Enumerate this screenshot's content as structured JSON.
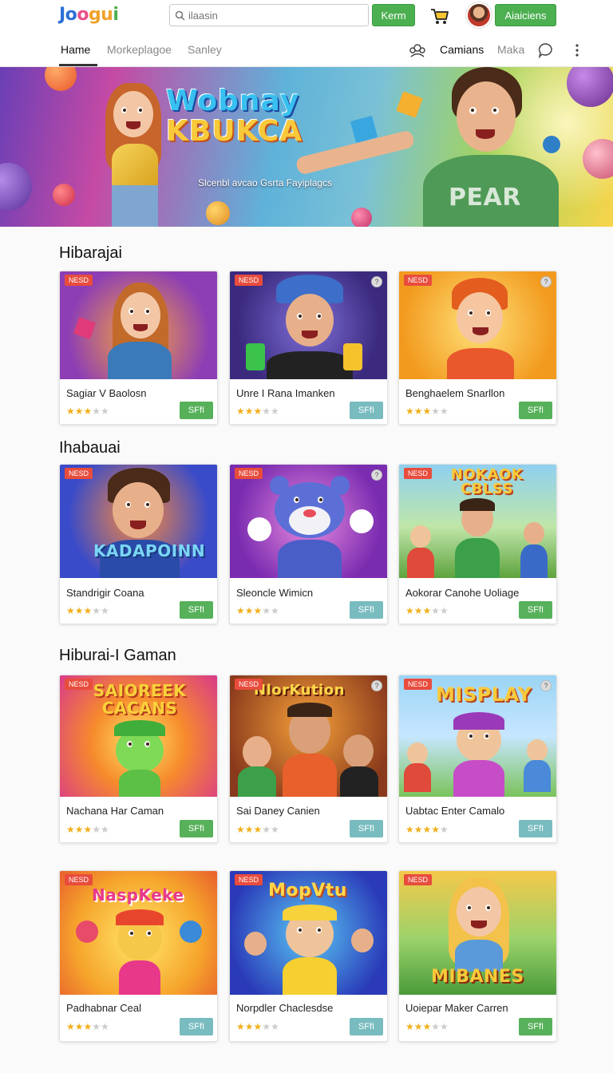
{
  "header": {
    "logo": [
      "Jo",
      "o",
      "gu",
      "i"
    ],
    "search_placeholder": "ilaasin",
    "search_button": "Kerm",
    "account_button": "Aiaiciens"
  },
  "nav": {
    "tabs": [
      {
        "label": "Hame",
        "active": true
      },
      {
        "label": "Morkeplagoe",
        "active": false
      },
      {
        "label": "Sanley",
        "active": false
      }
    ],
    "right_link_1": "Camians",
    "right_link_2": "Maka"
  },
  "banner": {
    "title_line1": "Wobnay",
    "title_line2": "KBUKCA",
    "subtitle": "Slcenbl avcao Gsrta Fayiplagcs",
    "shirt_text": "PEAR"
  },
  "sections": [
    {
      "title": "Hibarajai",
      "cards": [
        {
          "badge": "NESD",
          "title": "Sagiar V Baolosn",
          "rating": 3,
          "play": "SFfI",
          "play_style": "green",
          "art": ""
        },
        {
          "badge": "NESD",
          "title": "Unre I Rana Imanken",
          "rating": 3,
          "play": "SFfI",
          "play_style": "teal",
          "art": ""
        },
        {
          "badge": "NESD",
          "title": "Benghaelem Snarllon",
          "rating": 3,
          "play": "SFfI",
          "play_style": "green",
          "art": ""
        }
      ]
    },
    {
      "title": "Ihabauai",
      "cards": [
        {
          "badge": "NESD",
          "title": "Standrigir Coana",
          "rating": 3,
          "play": "SFfI",
          "play_style": "green",
          "art": "KADAPOINN"
        },
        {
          "badge": "NESD",
          "title": "Sleoncle Wimicn",
          "rating": 3,
          "play": "SFfI",
          "play_style": "teal",
          "art": ""
        },
        {
          "badge": "NESD",
          "title": "Aokorar Canohe Uoliage",
          "rating": 3,
          "play": "SFfI",
          "play_style": "green",
          "art": "NOKAOK CBLSS"
        }
      ]
    },
    {
      "title": "Hiburai-I Gaman",
      "cards": [
        {
          "badge": "NESD",
          "title": "Nachana Har Caman",
          "rating": 3,
          "play": "SFfI",
          "play_style": "green",
          "art": "SAIOREEK CACANS"
        },
        {
          "badge": "NESD",
          "title": "Sai Daney Canien",
          "rating": 3,
          "play": "SFfI",
          "play_style": "teal",
          "art": "NlorKution"
        },
        {
          "badge": "NESD",
          "title": "Uabtac Enter Camalo",
          "rating": 4,
          "play": "SFfI",
          "play_style": "teal",
          "art": "MISPLAY"
        }
      ]
    },
    {
      "title": "",
      "cards": [
        {
          "badge": "NESD",
          "title": "Padhabnar Ceal",
          "rating": 3,
          "play": "SFfI",
          "play_style": "teal",
          "art": "NaspKeke"
        },
        {
          "badge": "NESD",
          "title": "Norpdler Chaclesdse",
          "rating": 3,
          "play": "SFfI",
          "play_style": "teal",
          "art": "MopVtu"
        },
        {
          "badge": "NESD",
          "title": "Uoiepar Maker Carren",
          "rating": 3,
          "play": "SFfI",
          "play_style": "green",
          "art": "MIBANES"
        }
      ]
    }
  ],
  "colors": {
    "accent_green": "#4caf50",
    "badge_red": "#e84c3d",
    "star": "#f2b01e",
    "play_teal": "#79bcc0"
  }
}
